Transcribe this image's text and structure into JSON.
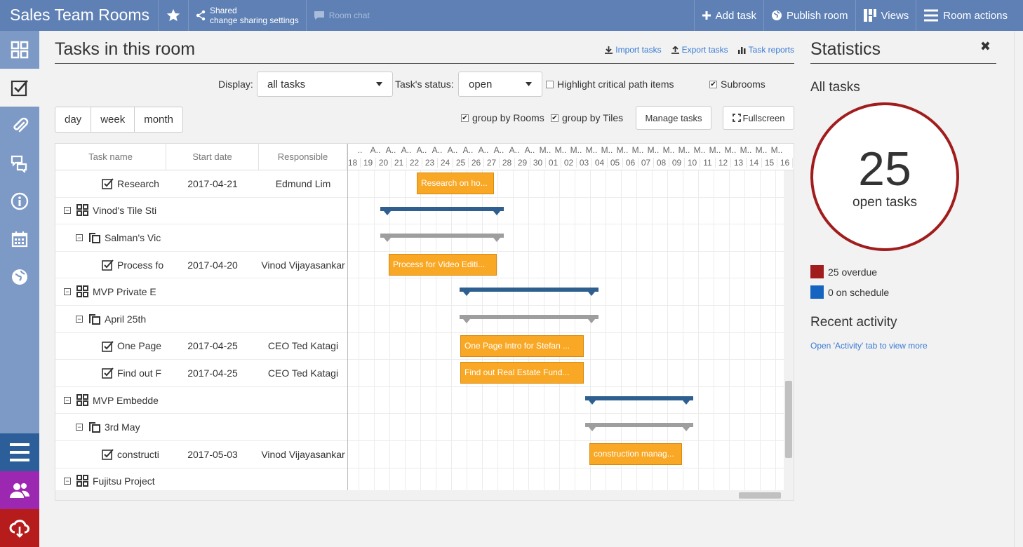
{
  "topbar": {
    "title": "Sales Team Rooms",
    "share_line1": "Shared",
    "share_line2": "change sharing settings",
    "room_chat": "Room chat",
    "add_task": "Add task",
    "publish_room": "Publish room",
    "views": "Views",
    "room_actions": "Room actions"
  },
  "main": {
    "title": "Tasks in this room",
    "links": {
      "import": "Import tasks",
      "export": "Export tasks",
      "reports": "Task reports"
    },
    "display_label": "Display:",
    "display_value": "all tasks",
    "status_label": "Task's status:",
    "status_value": "open",
    "highlight_label": "Highlight critical path items",
    "highlight_checked": false,
    "subrooms_label": "Subrooms",
    "subrooms_checked": true,
    "scale": {
      "day": "day",
      "week": "week",
      "month": "month"
    },
    "group_rooms_label": "group by Rooms",
    "group_tiles_label": "group by Tiles",
    "manage_tasks": "Manage tasks",
    "fullscreen": "Fullscreen"
  },
  "gantt": {
    "columns": {
      "name": "Task name",
      "start": "Start date",
      "responsible": "Responsible"
    },
    "month_letters": [
      "..",
      "A..",
      "A..",
      "A..",
      "A..",
      "A..",
      "A..",
      "A..",
      "A..",
      "A..",
      "A..",
      "A..",
      "M..",
      "M..",
      "M..",
      "M..",
      "M..",
      "M..",
      "M..",
      "M..",
      "M..",
      "M..",
      "M..",
      "M..",
      "M..",
      "M..",
      "M..",
      "M.."
    ],
    "days": [
      "18",
      "19",
      "20",
      "21",
      "22",
      "23",
      "24",
      "25",
      "26",
      "27",
      "28",
      "29",
      "30",
      "01",
      "02",
      "03",
      "04",
      "05",
      "06",
      "07",
      "08",
      "09",
      "10",
      "11",
      "12",
      "13",
      "14",
      "15",
      "16"
    ],
    "rows": [
      {
        "type": "task",
        "level": 2,
        "name": "Research",
        "start": "2017-04-21",
        "resp": "Edmund Lim",
        "bar": "Research on ho..."
      },
      {
        "type": "tile",
        "level": 0,
        "name": "Vinod's Tile Sti",
        "start": "",
        "resp": ""
      },
      {
        "type": "room",
        "level": 1,
        "name": "Salman's Vic",
        "start": "",
        "resp": ""
      },
      {
        "type": "task",
        "level": 2,
        "name": "Process fo",
        "start": "2017-04-20",
        "resp": "Vinod Vijayasankar",
        "bar": "Process for Video Editi..."
      },
      {
        "type": "tile",
        "level": 0,
        "name": "MVP Private E",
        "start": "",
        "resp": ""
      },
      {
        "type": "room",
        "level": 1,
        "name": "April 25th",
        "start": "",
        "resp": ""
      },
      {
        "type": "task",
        "level": 2,
        "name": "One Page",
        "start": "2017-04-25",
        "resp": "CEO Ted Katagi",
        "bar": "One Page Intro for Stefan ..."
      },
      {
        "type": "task",
        "level": 2,
        "name": "Find out F",
        "start": "2017-04-25",
        "resp": "CEO Ted Katagi",
        "bar": "Find out Real Estate Fund..."
      },
      {
        "type": "tile",
        "level": 0,
        "name": "MVP Embedde",
        "start": "",
        "resp": ""
      },
      {
        "type": "room",
        "level": 1,
        "name": "3rd May",
        "start": "",
        "resp": ""
      },
      {
        "type": "task",
        "level": 2,
        "name": "constructi",
        "start": "2017-05-03",
        "resp": "Vinod Vijayasankar",
        "bar": "construction manag..."
      },
      {
        "type": "tile",
        "level": 0,
        "name": "Fujitsu Project",
        "start": "",
        "resp": ""
      }
    ]
  },
  "stats": {
    "title": "Statistics",
    "all_tasks": "All tasks",
    "open_count": "25",
    "open_label": "open tasks",
    "overdue": "25 overdue",
    "on_schedule": "0 on schedule",
    "overdue_color": "#a11d1d",
    "schedule_color": "#1565c0",
    "recent_title": "Recent activity",
    "recent_link": "Open 'Activity' tab to view more"
  },
  "colors": {
    "topbar": "#5f80b5",
    "rail": "#7d9ac6",
    "task_bar": "#f9a825",
    "tile_summary": "#2f5f8f",
    "room_summary": "#9e9e9e"
  }
}
